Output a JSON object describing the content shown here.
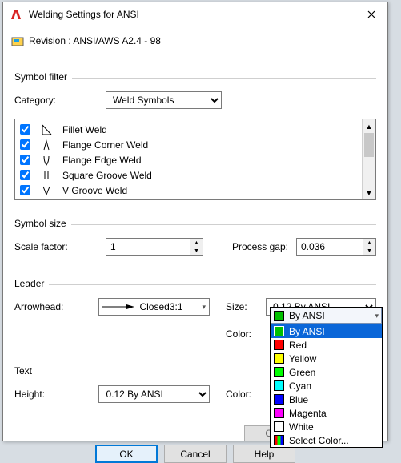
{
  "window": {
    "title": "Welding Settings for ANSI",
    "revision": "Revision : ANSI/AWS A2.4 - 98"
  },
  "symbol_filter": {
    "legend": "Symbol filter",
    "category_label": "Category:",
    "category_value": "Weld Symbols",
    "items": [
      {
        "checked": true,
        "label": "Fillet Weld"
      },
      {
        "checked": true,
        "label": "Flange Corner Weld"
      },
      {
        "checked": true,
        "label": "Flange Edge Weld"
      },
      {
        "checked": true,
        "label": "Square Groove Weld"
      },
      {
        "checked": true,
        "label": "V Groove Weld"
      }
    ]
  },
  "symbol_size": {
    "legend": "Symbol size",
    "scale_label": "Scale factor:",
    "scale_value": "1",
    "gap_label": "Process gap:",
    "gap_value": "0.036"
  },
  "leader": {
    "legend": "Leader",
    "arrowhead_label": "Arrowhead:",
    "arrowhead_value": "Closed3:1",
    "size_label": "Size:",
    "size_value": "0.12  By ANSI",
    "color_label": "Color:",
    "color_value": "By ANSI"
  },
  "text": {
    "legend": "Text",
    "height_label": "Height:",
    "height_value": "0.12  By ANSI",
    "color_label": "Color:"
  },
  "color_dropdown": {
    "field": {
      "label": "By ANSI",
      "swatch": "#00c000"
    },
    "options": [
      {
        "label": "By ANSI",
        "swatch": "#00c000",
        "selected": true
      },
      {
        "label": "Red",
        "swatch": "#ff0000"
      },
      {
        "label": "Yellow",
        "swatch": "#ffff00"
      },
      {
        "label": "Green",
        "swatch": "#00ff00"
      },
      {
        "label": "Cyan",
        "swatch": "#00ffff"
      },
      {
        "label": "Blue",
        "swatch": "#0000ff"
      },
      {
        "label": "Magenta",
        "swatch": "#ff00ff"
      },
      {
        "label": "White",
        "swatch": "#ffffff"
      },
      {
        "label": "Select Color...",
        "swatch": "multi"
      }
    ]
  },
  "buttons": {
    "ok": "OK",
    "cancel": "Cancel",
    "help": "Help"
  },
  "ghost": {
    "ok": "OK"
  }
}
